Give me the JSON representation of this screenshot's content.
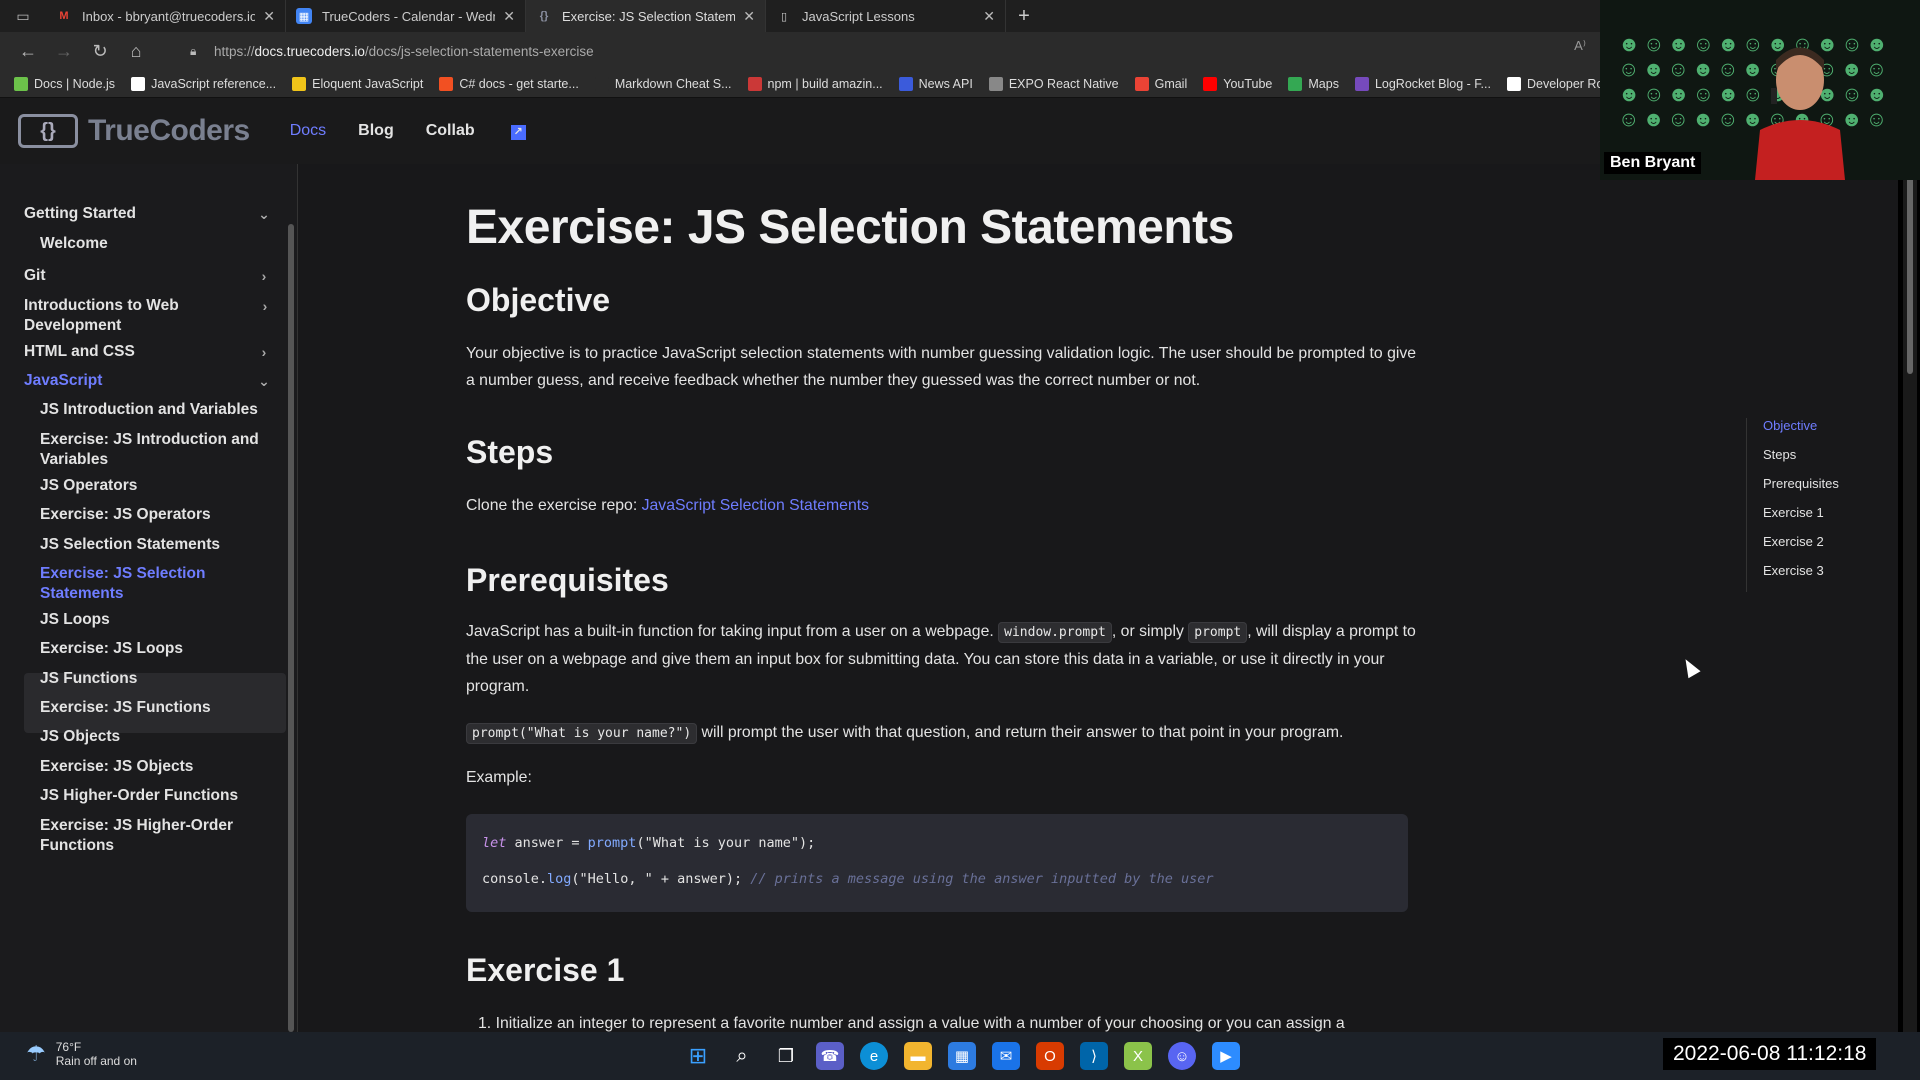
{
  "browser": {
    "tabs": [
      {
        "title": "Inbox - bbryant@truecoders.io -",
        "icon": "gmail-icon",
        "active": false
      },
      {
        "title": "TrueCoders - Calendar - Wednes",
        "icon": "calendar-icon",
        "active": false
      },
      {
        "title": "Exercise: JS Selection Statements",
        "icon": "truecoders-icon",
        "active": true
      },
      {
        "title": "JavaScript Lessons",
        "icon": "page-icon",
        "active": false
      }
    ],
    "url_prefix": "https://",
    "url_host": "docs.truecoders.io",
    "url_path": "/docs/js-selection-statements-exercise",
    "bookmarks": [
      {
        "label": "Docs | Node.js",
        "color": "#6cc24a"
      },
      {
        "label": "JavaScript reference...",
        "color": "#ffffff"
      },
      {
        "label": "Eloquent JavaScript",
        "color": "#f0c419"
      },
      {
        "label": "C# docs - get starte...",
        "color": "#f25022"
      },
      {
        "label": "Markdown Cheat S...",
        "color": "#2b2b2b"
      },
      {
        "label": "npm | build amazin...",
        "color": "#cb3837"
      },
      {
        "label": "News API",
        "color": "#3b5bdb"
      },
      {
        "label": "EXPO React Native",
        "color": "#888888"
      },
      {
        "label": "Gmail",
        "color": "#ea4335"
      },
      {
        "label": "YouTube",
        "color": "#ff0000"
      },
      {
        "label": "Maps",
        "color": "#34a853"
      },
      {
        "label": "LogRocket Blog - F...",
        "color": "#764abc"
      },
      {
        "label": "Developer Roadm...",
        "color": "#ffffff"
      }
    ]
  },
  "site": {
    "logo_text": "TrueCoders",
    "nav": {
      "docs": "Docs",
      "blog": "Blog",
      "collab": "Collab"
    }
  },
  "sidebar": {
    "items": [
      {
        "label": "Getting Started",
        "level": "top",
        "chevron": "down"
      },
      {
        "label": "Welcome",
        "level": "sub"
      },
      {
        "label": "Git",
        "level": "top",
        "chevron": "right"
      },
      {
        "label": "Introductions to Web Development",
        "level": "top",
        "chevron": "right"
      },
      {
        "label": "HTML and CSS",
        "level": "top",
        "chevron": "right"
      },
      {
        "label": "JavaScript",
        "level": "top",
        "chevron": "down",
        "active": true
      },
      {
        "label": "JS Introduction and Variables",
        "level": "sub"
      },
      {
        "label": "Exercise: JS Introduction and Variables",
        "level": "sub"
      },
      {
        "label": "JS Operators",
        "level": "sub"
      },
      {
        "label": "Exercise: JS Operators",
        "level": "sub"
      },
      {
        "label": "JS Selection Statements",
        "level": "sub"
      },
      {
        "label": "Exercise: JS Selection Statements",
        "level": "sub",
        "active": true
      },
      {
        "label": "JS Loops",
        "level": "sub"
      },
      {
        "label": "Exercise: JS Loops",
        "level": "sub"
      },
      {
        "label": "JS Functions",
        "level": "sub"
      },
      {
        "label": "Exercise: JS Functions",
        "level": "sub"
      },
      {
        "label": "JS Objects",
        "level": "sub"
      },
      {
        "label": "Exercise: JS Objects",
        "level": "sub"
      },
      {
        "label": "JS Higher-Order Functions",
        "level": "sub"
      },
      {
        "label": "Exercise: JS Higher-Order Functions",
        "level": "sub"
      }
    ]
  },
  "content": {
    "title": "Exercise: JS Selection Statements",
    "objective_heading": "Objective",
    "objective_text": "Your objective is to practice JavaScript selection statements with number guessing validation logic. The user should be prompted to give a number guess, and receive feedback whether the number they guessed was the correct number or not.",
    "steps_heading": "Steps",
    "steps_text": "Clone the exercise repo:",
    "steps_link": "JavaScript Selection Statements",
    "prereq_heading": "Prerequisites",
    "prereq_p1_a": "JavaScript has a built-in function for taking input from a user on a webpage.",
    "prereq_code1": "window.prompt",
    "prereq_p1_b": ", or simply",
    "prereq_code2": "prompt",
    "prereq_p1_c": ", will display a prompt to the user on a webpage and give them an input box for submitting data. You can store this data in a variable, or use it directly in your program.",
    "prereq_code3": "prompt(\"What is your name?\")",
    "prereq_p2": "will prompt the user with that question, and return their answer to that point in your program.",
    "example_label": "Example:",
    "code_line1": {
      "kw": "let",
      "mid": " answer = ",
      "fn": "prompt",
      "rest": "(\"What is your name\");"
    },
    "code_line2": {
      "start": "console.",
      "fn": "log",
      "rest": "(\"Hello, \" + answer); ",
      "comment": "// prints a message using the answer inputted by the user"
    },
    "exercise1_heading": "Exercise 1",
    "exercise1_item1": "1. Initialize an integer to represent a favorite number and assign a value with a number of your choosing or you can assign a"
  },
  "toc": [
    "Objective",
    "Steps",
    "Prerequisites",
    "Exercise 1",
    "Exercise 2",
    "Exercise 3"
  ],
  "webcam": {
    "name": "Ben Bryant"
  },
  "taskbar": {
    "temp": "76°F",
    "weather": "Rain off and on",
    "clock": "2022-06-08  11:12:18",
    "icons": [
      "windows-start-icon",
      "search-icon",
      "task-view-icon",
      "teams-chat-icon",
      "edge-icon",
      "file-explorer-icon",
      "store-icon",
      "mail-icon",
      "office-icon",
      "vscode-icon",
      "excel-icon",
      "discord-icon",
      "zoom-icon"
    ]
  }
}
